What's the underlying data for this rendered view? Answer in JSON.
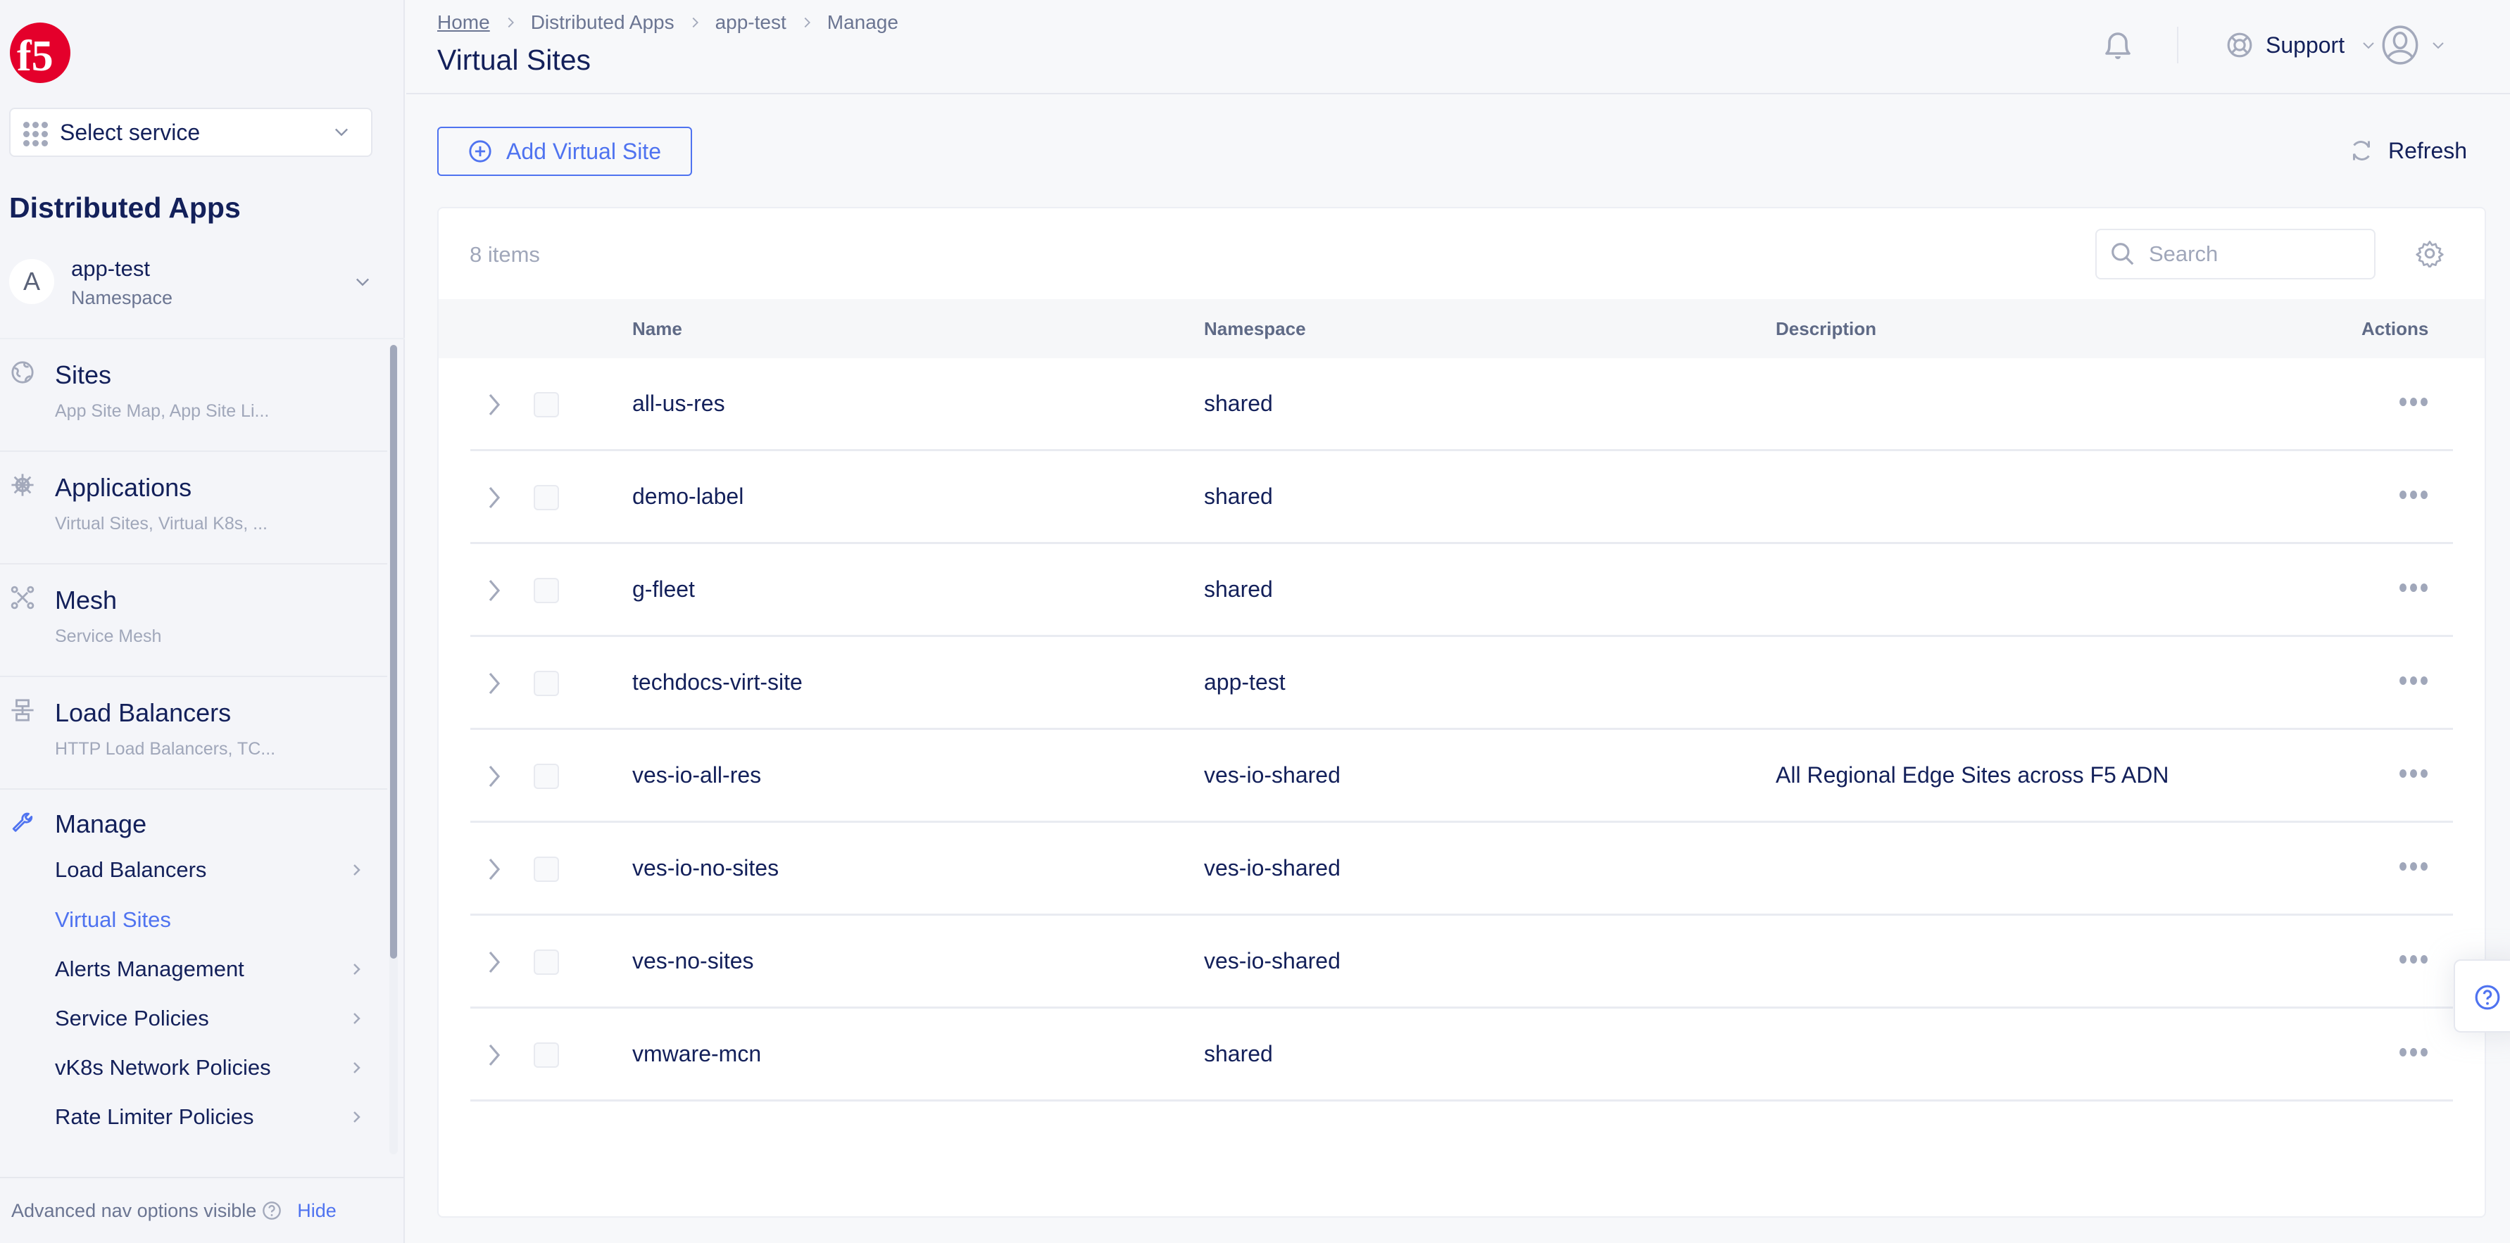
{
  "sidebar": {
    "logo": "f5",
    "service_select": {
      "label": "Select service",
      "icon": "grid-dots-icon"
    },
    "app_title": "Distributed Apps",
    "namespace": {
      "avatar_letter": "A",
      "name": "app-test",
      "type_label": "Namespace"
    },
    "groups": [
      {
        "title": "Sites",
        "subtitle": "App Site Map, App Site Li...",
        "icon": "globe-icon"
      },
      {
        "title": "Applications",
        "subtitle": "Virtual Sites, Virtual K8s, ...",
        "icon": "helm-icon"
      },
      {
        "title": "Mesh",
        "subtitle": "Service Mesh",
        "icon": "mesh-icon"
      },
      {
        "title": "Load Balancers",
        "subtitle": "HTTP Load Balancers, TC...",
        "icon": "load-balancer-icon"
      }
    ],
    "manage": {
      "title": "Manage",
      "icon": "wrench-icon",
      "items": [
        {
          "label": "Load Balancers",
          "has_submenu": true,
          "active": false
        },
        {
          "label": "Virtual Sites",
          "has_submenu": false,
          "active": true
        },
        {
          "label": "Alerts Management",
          "has_submenu": true,
          "active": false
        },
        {
          "label": "Service Policies",
          "has_submenu": true,
          "active": false
        },
        {
          "label": "vK8s Network Policies",
          "has_submenu": true,
          "active": false
        },
        {
          "label": "Rate Limiter Policies",
          "has_submenu": true,
          "active": false
        }
      ]
    },
    "footer": {
      "text": "Advanced nav options visible",
      "hide_label": "Hide"
    }
  },
  "header": {
    "breadcrumb": [
      {
        "label": "Home",
        "link": true
      },
      {
        "label": "Distributed Apps",
        "link": false
      },
      {
        "label": "app-test",
        "link": false
      },
      {
        "label": "Manage",
        "link": false
      }
    ],
    "title": "Virtual Sites",
    "support_label": "Support"
  },
  "toolbar": {
    "add_label": "Add Virtual Site",
    "refresh_label": "Refresh"
  },
  "table": {
    "count_label": "8 items",
    "search_placeholder": "Search",
    "search_value": "",
    "columns": [
      "Name",
      "Namespace",
      "Description",
      "Actions"
    ],
    "rows": [
      {
        "name": "all-us-res",
        "namespace": "shared",
        "description": ""
      },
      {
        "name": "demo-label",
        "namespace": "shared",
        "description": ""
      },
      {
        "name": "g-fleet",
        "namespace": "shared",
        "description": ""
      },
      {
        "name": "techdocs-virt-site",
        "namespace": "app-test",
        "description": ""
      },
      {
        "name": "ves-io-all-res",
        "namespace": "ves-io-shared",
        "description": "All Regional Edge Sites across F5 ADN"
      },
      {
        "name": "ves-io-no-sites",
        "namespace": "ves-io-shared",
        "description": ""
      },
      {
        "name": "ves-no-sites",
        "namespace": "ves-io-shared",
        "description": ""
      },
      {
        "name": "vmware-mcn",
        "namespace": "shared",
        "description": ""
      }
    ]
  },
  "colors": {
    "accent": "#4f73f0",
    "text_primary": "#13205a",
    "text_muted": "#a0a7ba",
    "brand_red": "#e4002b"
  }
}
